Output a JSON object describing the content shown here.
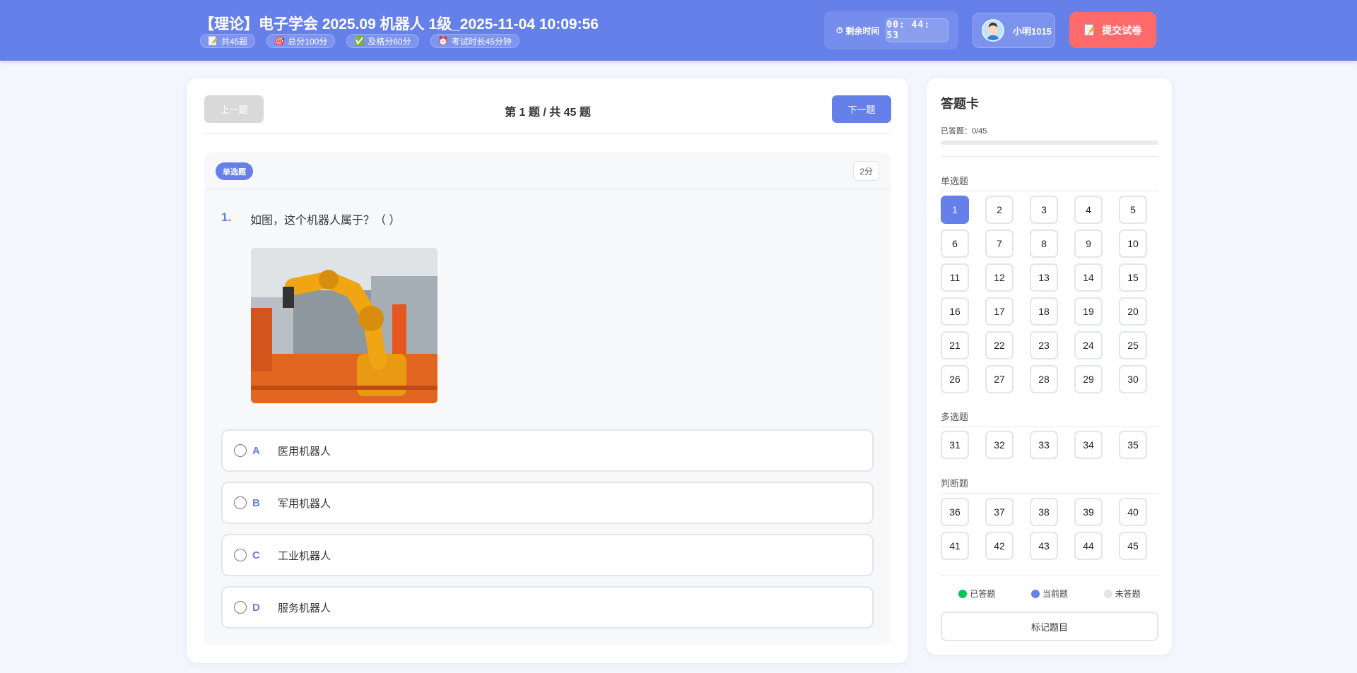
{
  "header": {
    "title": "【理论】电子学会 2025.09 机器人 1级_2025-11-04 10:09:56",
    "tags": [
      {
        "icon": "memo-icon",
        "label": "共45题"
      },
      {
        "icon": "target-icon",
        "label": "总分100分"
      },
      {
        "icon": "check-icon",
        "label": "及格分60分"
      },
      {
        "icon": "alarm-clock-icon",
        "label": "考试时长45分钟"
      }
    ],
    "timer_label": "剩余时间",
    "timer_value": "00: 44: 53",
    "user_name": "小明1015",
    "submit_label": "提交试卷"
  },
  "nav": {
    "prev_label": "上一题",
    "next_label": "下一题",
    "counter": "第 1 题 / 共 45 题"
  },
  "question": {
    "type": "单选题",
    "score": "2分",
    "number": "1.",
    "text": "如图，这个机器人属于？（ ）",
    "options": [
      {
        "key": "A",
        "text": "医用机器人"
      },
      {
        "key": "B",
        "text": "军用机器人"
      },
      {
        "key": "C",
        "text": "工业机器人"
      },
      {
        "key": "D",
        "text": "服务机器人"
      }
    ]
  },
  "card": {
    "title": "答题卡",
    "progress_text": "已答题：0/45",
    "progress": 0,
    "sections": [
      {
        "title": "单选题",
        "start": 1,
        "end": 30
      },
      {
        "title": "多选题",
        "start": 31,
        "end": 35
      },
      {
        "title": "判断题",
        "start": 36,
        "end": 45
      }
    ],
    "current": 1,
    "legend": [
      {
        "label": "已答题",
        "color": "#00c853"
      },
      {
        "label": "当前题",
        "color": "#6680ea"
      },
      {
        "label": "未答题",
        "color": "#e3e5ec"
      }
    ],
    "mark_label": "标记题目"
  },
  "colors": {
    "primary": "#6680ea",
    "danger": "#ff6b6b"
  }
}
